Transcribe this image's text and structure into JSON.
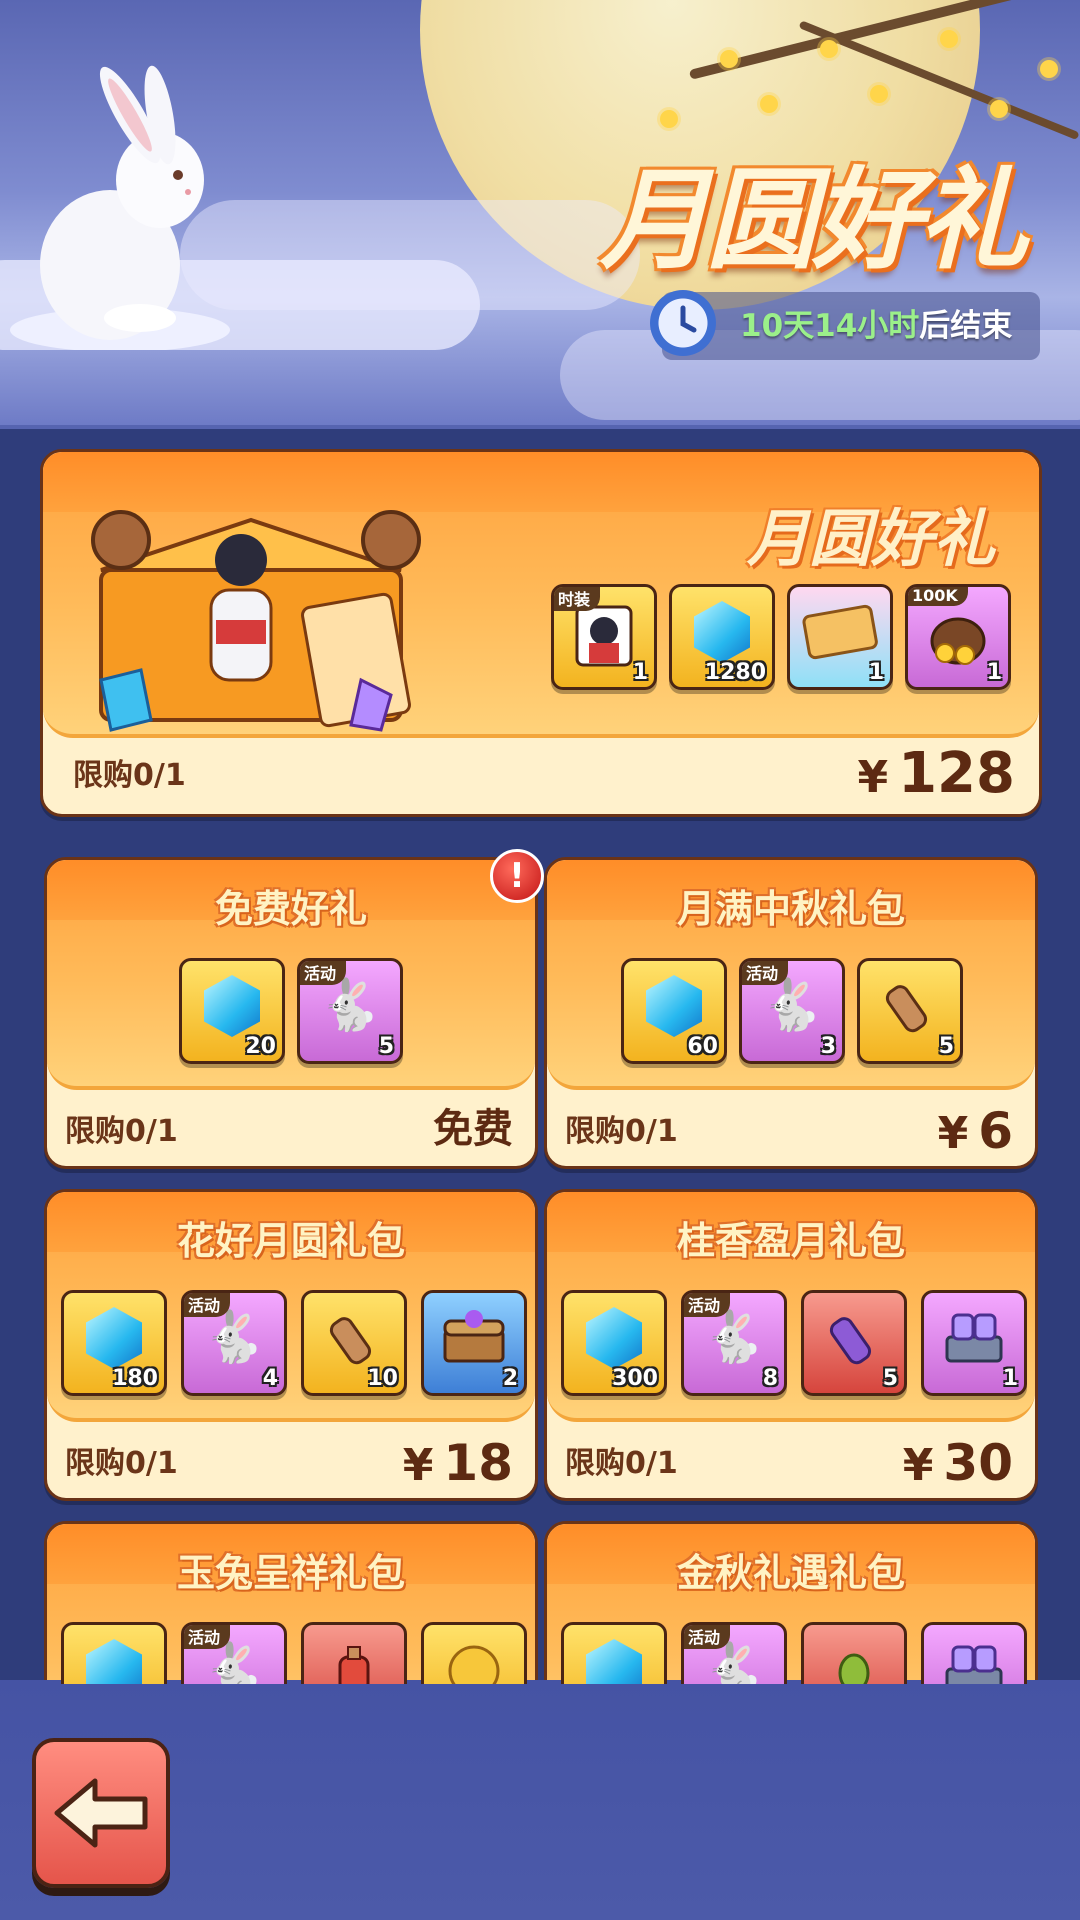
{
  "banner": {
    "title": "月圆好礼",
    "timer_highlight": "10天14小时",
    "timer_suffix": "后结束",
    "icon": "clock-icon"
  },
  "featured": {
    "title": "月圆好礼",
    "limit": "限购0/1",
    "currency": "¥",
    "price": "128",
    "items": [
      {
        "icon": "costume-portrait-icon",
        "tag": "时装",
        "qty": "1"
      },
      {
        "icon": "diamond-icon",
        "qty": "1280"
      },
      {
        "icon": "ticket-card-icon",
        "qty": "1"
      },
      {
        "icon": "coin-bag-icon",
        "tag": "100K",
        "qty": "1"
      }
    ]
  },
  "packs": [
    {
      "title": "免费好礼",
      "limit": "限购0/1",
      "price_text": "免费",
      "has_alert": true,
      "alert_text": "!",
      "items": [
        {
          "icon": "diamond-icon",
          "qty": "20"
        },
        {
          "icon": "rabbit-lantern-icon",
          "tag": "活动",
          "qty": "5"
        }
      ]
    },
    {
      "title": "月满中秋礼包",
      "limit": "限购0/1",
      "currency": "¥",
      "price": "6",
      "items": [
        {
          "icon": "diamond-icon",
          "qty": "60"
        },
        {
          "icon": "rabbit-lantern-icon",
          "tag": "活动",
          "qty": "3"
        },
        {
          "icon": "scroll-icon",
          "qty": "5"
        }
      ]
    },
    {
      "title": "花好月圆礼包",
      "limit": "限购0/1",
      "currency": "¥",
      "price": "18",
      "items": [
        {
          "icon": "diamond-icon",
          "qty": "180"
        },
        {
          "icon": "rabbit-lantern-icon",
          "tag": "活动",
          "qty": "4"
        },
        {
          "icon": "scroll-icon",
          "qty": "10"
        },
        {
          "icon": "treasure-chest-icon",
          "qty": "2"
        }
      ]
    },
    {
      "title": "桂香盈月礼包",
      "limit": "限购0/1",
      "currency": "¥",
      "price": "30",
      "items": [
        {
          "icon": "diamond-icon",
          "qty": "300"
        },
        {
          "icon": "rabbit-lantern-icon",
          "tag": "活动",
          "qty": "8"
        },
        {
          "icon": "purple-scroll-icon",
          "qty": "5"
        },
        {
          "icon": "mask-chest-icon",
          "qty": "1"
        }
      ]
    },
    {
      "title": "玉兔呈祥礼包",
      "items": [
        {
          "icon": "diamond-icon"
        },
        {
          "icon": "rabbit-lantern-icon",
          "tag": "活动"
        },
        {
          "icon": "potion-icon"
        },
        {
          "icon": "gold-coin-icon"
        }
      ]
    },
    {
      "title": "金秋礼遇礼包",
      "items": [
        {
          "icon": "diamond-icon"
        },
        {
          "icon": "rabbit-lantern-icon",
          "tag": "活动"
        },
        {
          "icon": "seed-icon"
        },
        {
          "icon": "mask-chest-icon"
        }
      ]
    }
  ],
  "nav": {
    "back_icon": "back-arrow-icon"
  }
}
